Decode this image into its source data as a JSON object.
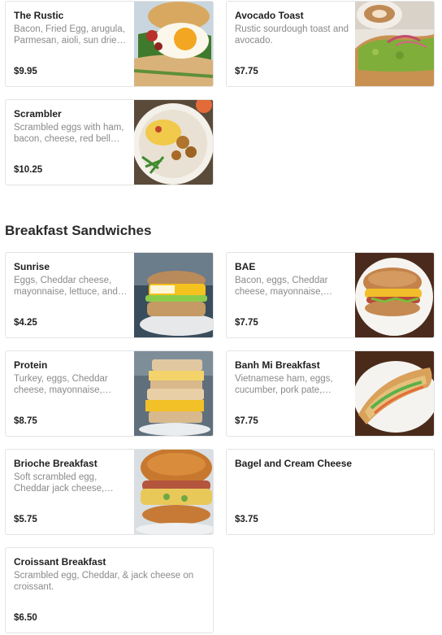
{
  "menu": {
    "items_above": [
      {
        "title": "The Rustic",
        "description": "Bacon, Fried Egg, arugula, Parmesan, aioli, sun dried tomato",
        "price": "$9.95",
        "image": "fried-egg-toast-photo"
      },
      {
        "title": "Avocado Toast",
        "description": "Rustic sourdough toast and avocado.",
        "price": "$7.75",
        "image": "avocado-toast-photo"
      },
      {
        "title": "Scrambler",
        "description": "Scrambled eggs with ham, bacon, cheese, red bell pepper",
        "price": "$10.25",
        "image": "scramble-plate-photo"
      }
    ],
    "section": {
      "title": "Breakfast Sandwiches",
      "items": [
        {
          "title": "Sunrise",
          "description": "Eggs, Cheddar cheese, mayonnaise, lettuce, and tomato",
          "price": "$4.25",
          "image": "sunrise-sandwich-photo"
        },
        {
          "title": "BAE",
          "description": "Bacon, eggs, Cheddar cheese, mayonnaise, lettuce",
          "price": "$7.75",
          "image": "bae-sandwich-photo"
        },
        {
          "title": "Protein",
          "description": "Turkey, eggs, Cheddar cheese, mayonnaise, lettuce",
          "price": "$8.75",
          "image": "protein-sandwich-photo"
        },
        {
          "title": "Banh Mi Breakfast",
          "description": "Vietnamese ham, eggs, cucumber, pork pate, cilantro",
          "price": "$7.75",
          "image": "banh-mi-photo"
        },
        {
          "title": "Brioche Breakfast",
          "description": "Soft scrambled egg, Cheddar jack cheese, bacon",
          "price": "$5.75",
          "image": "brioche-sandwich-photo"
        },
        {
          "title": "Bagel and Cream Cheese",
          "description": "",
          "price": "$3.75"
        },
        {
          "title": "Croissant Breakfast",
          "description": "Scrambled egg, Cheddar, & jack cheese on croissant.",
          "price": "$6.50"
        }
      ]
    }
  }
}
